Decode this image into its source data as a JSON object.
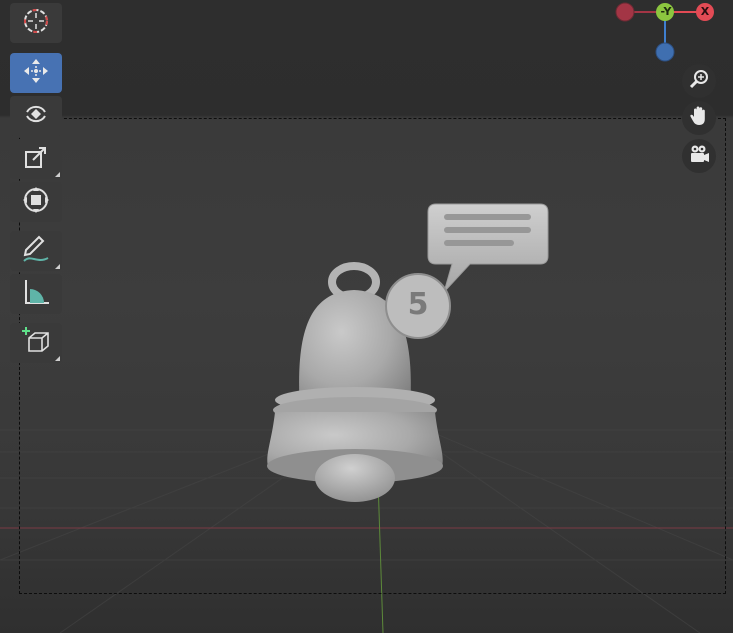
{
  "viewport": {
    "gizmo": {
      "axes": [
        {
          "label": "",
          "color": "#a33545"
        },
        {
          "label": "-Y",
          "color": "#8cc63f"
        },
        {
          "label": "X",
          "color": "#e34b55"
        },
        {
          "label": "",
          "color": "#3f7fcf"
        }
      ]
    },
    "nav_buttons": [
      "zoom-icon",
      "hand-pan-icon",
      "camera-icon"
    ]
  },
  "toolbar": {
    "tools": [
      {
        "name": "cursor-tool",
        "icon": "cursor-icon",
        "active": false
      },
      {
        "name": "move-tool",
        "icon": "move-icon",
        "active": true
      },
      {
        "name": "rotate-tool",
        "icon": "rotate-icon",
        "active": false
      },
      {
        "name": "scale-tool",
        "icon": "scale-icon",
        "active": false
      },
      {
        "name": "transform-tool",
        "icon": "transform-icon",
        "active": false
      },
      {
        "name": "annotate-tool",
        "icon": "annotate-pencil-icon",
        "active": false
      },
      {
        "name": "measure-tool",
        "icon": "measure-ruler-icon",
        "active": false
      },
      {
        "name": "add-cube-tool",
        "icon": "add-cube-icon",
        "active": false
      }
    ],
    "accent_color": "#4772b3"
  },
  "model": {
    "badge_number": "5",
    "object": "bell-notification"
  }
}
